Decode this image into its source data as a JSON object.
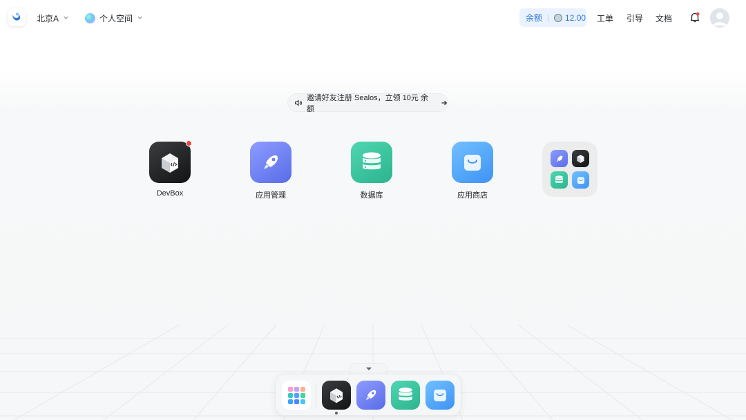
{
  "header": {
    "region": "北京A",
    "workspace": "个人空间",
    "balance_label": "余额",
    "balance_value": "12.00",
    "nav": [
      "工单",
      "引导",
      "文档"
    ]
  },
  "banner": {
    "text": "邀请好友注册 Sealos，立领 10元 余额"
  },
  "apps": [
    {
      "label": "DevBox",
      "icon": "devbox-icon",
      "badge": true
    },
    {
      "label": "应用管理",
      "icon": "rocket-icon",
      "badge": false
    },
    {
      "label": "数据库",
      "icon": "database-icon",
      "badge": false
    },
    {
      "label": "应用商店",
      "icon": "shopping-bag-icon",
      "badge": false
    }
  ],
  "folder": {
    "icons": [
      "rocket-icon",
      "devbox-icon",
      "database-icon",
      "shopping-bag-icon"
    ]
  },
  "dock": {
    "items": [
      "app-grid-icon",
      "devbox-icon",
      "rocket-icon",
      "database-icon",
      "shopping-bag-icon"
    ],
    "active": "devbox-icon"
  },
  "colors": {
    "accent": "#2f7ad8",
    "balance_bg": "#eaf3fd",
    "notification_dot": "#ef4444"
  }
}
